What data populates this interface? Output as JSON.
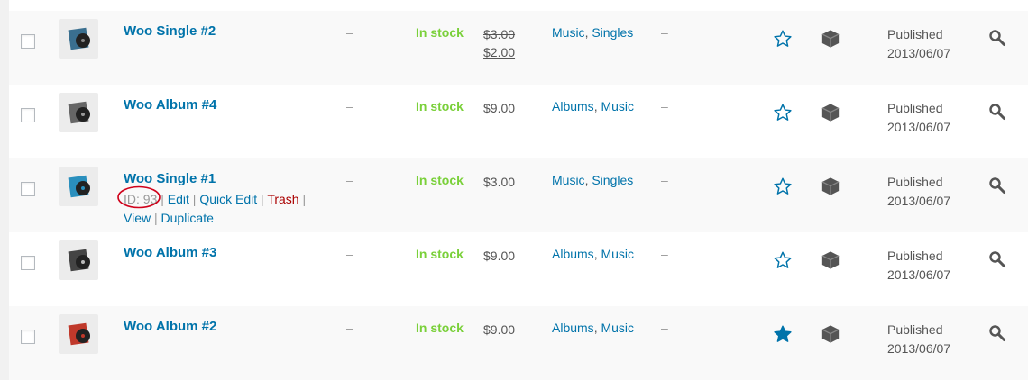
{
  "rows": [
    {
      "name": "Woo Single #2",
      "sku": "–",
      "stock": "In stock",
      "price_regular": "$3.00",
      "price_sale": "$2.00",
      "categories": [
        "Music",
        "Singles"
      ],
      "tags": "–",
      "featured": false,
      "status": "Published",
      "date": "2013/06/07",
      "thumb_color": "#3a6f8f",
      "actions": null
    },
    {
      "name": "Woo Album #4",
      "sku": "–",
      "stock": "In stock",
      "price": "$9.00",
      "categories": [
        "Albums",
        "Music"
      ],
      "tags": "–",
      "featured": false,
      "status": "Published",
      "date": "2013/06/07",
      "thumb_color": "#666666",
      "actions": null
    },
    {
      "name": "Woo Single #1",
      "sku": "–",
      "stock": "In stock",
      "price": "$3.00",
      "categories": [
        "Music",
        "Singles"
      ],
      "tags": "–",
      "featured": false,
      "status": "Published",
      "date": "2013/06/07",
      "thumb_color": "#2a8fbd",
      "actions": {
        "id_label": "ID: 93",
        "edit": "Edit",
        "quick_edit": "Quick Edit",
        "trash": "Trash",
        "view": "View",
        "duplicate": "Duplicate",
        "separator": "|"
      }
    },
    {
      "name": "Woo Album #3",
      "sku": "–",
      "stock": "In stock",
      "price": "$9.00",
      "categories": [
        "Albums",
        "Music"
      ],
      "tags": "–",
      "featured": false,
      "status": "Published",
      "date": "2013/06/07",
      "thumb_color": "#444444",
      "actions": null
    },
    {
      "name": "Woo Album #2",
      "sku": "–",
      "stock": "In stock",
      "price": "$9.00",
      "categories": [
        "Albums",
        "Music"
      ],
      "tags": "–",
      "featured": true,
      "status": "Published",
      "date": "2013/06/07",
      "thumb_color": "#c0392b",
      "actions": null
    }
  ],
  "colors": {
    "link": "#0073aa",
    "in_stock": "#7ad03a",
    "trash": "#aa0000",
    "annotation": "#d0021b",
    "icon": "#555555"
  },
  "icons": {
    "featured_empty": "star-outline-icon",
    "featured_filled": "star-filled-icon",
    "product_type": "box-icon",
    "search": "magnifier-icon"
  }
}
